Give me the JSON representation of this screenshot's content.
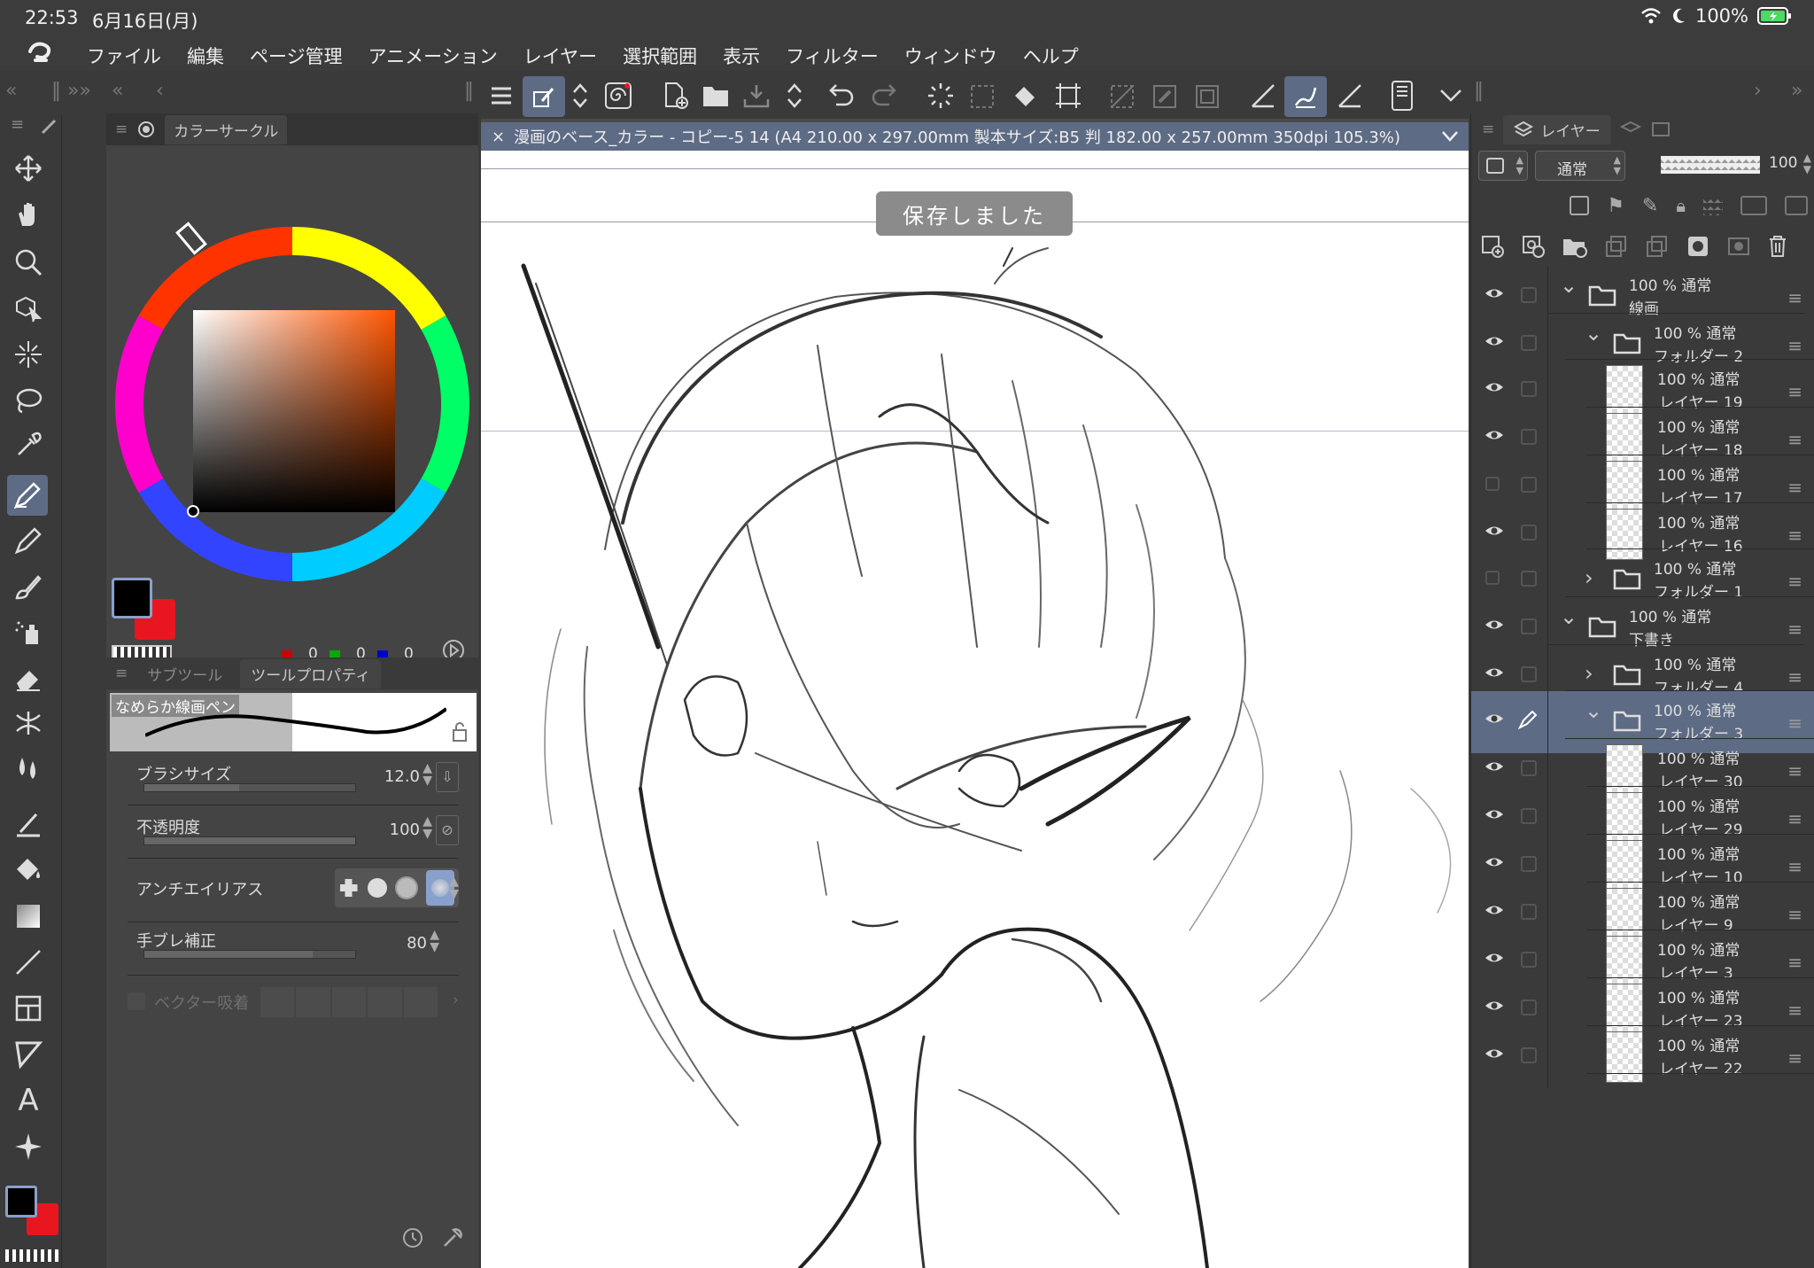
{
  "status": {
    "time": "22:53",
    "date": "6月16日(月)",
    "battery": "100%"
  },
  "menu": {
    "items": [
      "ファイル",
      "編集",
      "ページ管理",
      "アニメーション",
      "レイヤー",
      "選択範囲",
      "表示",
      "フィルター",
      "ウィンドウ",
      "ヘルプ"
    ]
  },
  "doc_tab": {
    "title": "漫画のベース_カラー - コピー-5 14 (A4 210.00 x 297.00mm 製本サイズ:B5 判 182.00 x 257.00mm 350dpi 105.3%)"
  },
  "toast": {
    "text": "保存しました"
  },
  "color_panel": {
    "title": "カラーサークル",
    "r": "0",
    "g": "0",
    "b": "0",
    "main_color": "#000000",
    "sub_color": "#e8161e"
  },
  "tool_panel": {
    "tabs": [
      "サブツール",
      "ツールプロパティ"
    ],
    "brush_name": "なめらか線画ペン",
    "props": [
      {
        "label": "ブラシサイズ",
        "value": "12.0"
      },
      {
        "label": "不透明度",
        "value": "100"
      },
      {
        "label": "アンチエイリアス",
        "value": ""
      },
      {
        "label": "手ブレ補正",
        "value": "80"
      },
      {
        "label": "ベクター吸着",
        "value": ""
      }
    ]
  },
  "layer_panel": {
    "tab": "レイヤー",
    "blend_mode": "通常",
    "opacity": "100",
    "layers": [
      {
        "l1": "100 % 通常",
        "l2": "線画",
        "type": "folder",
        "indent": 0,
        "open": true,
        "visible": true
      },
      {
        "l1": "100 % 通常",
        "l2": "フォルダー 2",
        "type": "folder",
        "indent": 1,
        "open": true,
        "visible": true
      },
      {
        "l1": "100 % 通常",
        "l2": "レイヤー 19",
        "type": "layer",
        "indent": 2,
        "visible": true
      },
      {
        "l1": "100 % 通常",
        "l2": "レイヤー 18",
        "type": "layer",
        "indent": 2,
        "visible": true
      },
      {
        "l1": "100 % 通常",
        "l2": "レイヤー 17",
        "type": "layer",
        "indent": 2,
        "visible": false
      },
      {
        "l1": "100 % 通常",
        "l2": "レイヤー 16",
        "type": "layer",
        "indent": 2,
        "visible": true
      },
      {
        "l1": "100 % 通常",
        "l2": "フォルダー 1",
        "type": "folder",
        "indent": 1,
        "open": false,
        "visible": false
      },
      {
        "l1": "100 % 通常",
        "l2": "下書き",
        "type": "folder",
        "indent": 0,
        "open": true,
        "visible": true
      },
      {
        "l1": "100 % 通常",
        "l2": "フォルダー 4",
        "type": "folder",
        "indent": 1,
        "open": false,
        "visible": true
      },
      {
        "l1": "100 % 通常",
        "l2": "フォルダー 3",
        "type": "folder",
        "indent": 1,
        "open": true,
        "visible": true,
        "selected": true
      },
      {
        "l1": "100 % 通常",
        "l2": "レイヤー 30",
        "type": "layer",
        "indent": 2,
        "visible": true
      },
      {
        "l1": "100 % 通常",
        "l2": "レイヤー 29",
        "type": "layer",
        "indent": 2,
        "visible": true
      },
      {
        "l1": "100 % 通常",
        "l2": "レイヤー 10",
        "type": "layer",
        "indent": 2,
        "visible": true
      },
      {
        "l1": "100 % 通常",
        "l2": "レイヤー 9",
        "type": "layer",
        "indent": 2,
        "visible": true
      },
      {
        "l1": "100 % 通常",
        "l2": "レイヤー 3",
        "type": "layer",
        "indent": 2,
        "visible": true
      },
      {
        "l1": "100 % 通常",
        "l2": "レイヤー 23",
        "type": "layer",
        "indent": 2,
        "visible": true
      },
      {
        "l1": "100 % 通常",
        "l2": "レイヤー 22",
        "type": "layer",
        "indent": 2,
        "visible": true
      }
    ]
  },
  "icons": {
    "accent": "#5d6b85"
  }
}
